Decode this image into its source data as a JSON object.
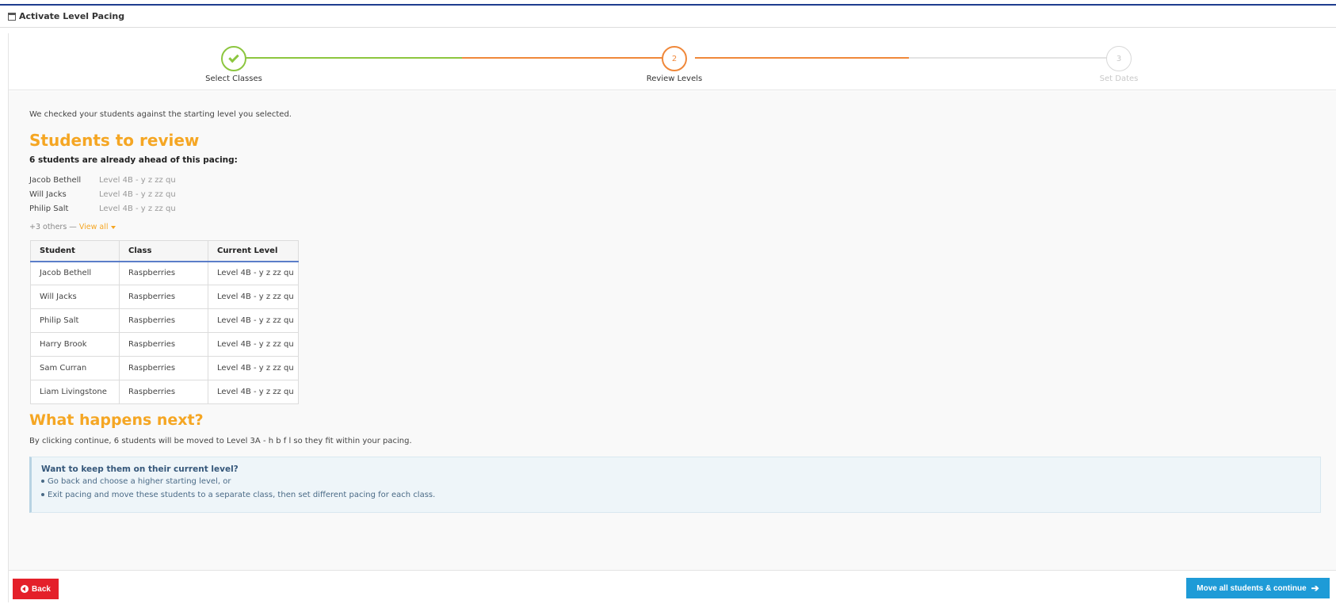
{
  "window": {
    "title": "Activate Level Pacing"
  },
  "steps": [
    {
      "number": "1",
      "label": "Select Classes",
      "state": "complete"
    },
    {
      "number": "2",
      "label": "Review Levels",
      "state": "current"
    },
    {
      "number": "3",
      "label": "Set Dates",
      "state": "upcoming"
    }
  ],
  "content": {
    "intro": "We checked your students against the starting level you selected.",
    "review_heading": "Students to review",
    "ahead_text": "6 students are already ahead of this pacing:",
    "preview": [
      {
        "name": "Jacob Bethell",
        "level": "Level 4B - y z zz qu"
      },
      {
        "name": "Will Jacks",
        "level": "Level 4B - y z zz qu"
      },
      {
        "name": "Philip Salt",
        "level": "Level 4B - y z zz qu"
      }
    ],
    "others_text": "+3 others —",
    "view_all": "View all",
    "table": {
      "headers": [
        "Student",
        "Class",
        "Current Level"
      ],
      "rows": [
        [
          "Jacob Bethell",
          "Raspberries",
          "Level 4B - y z zz qu"
        ],
        [
          "Will Jacks",
          "Raspberries",
          "Level 4B - y z zz qu"
        ],
        [
          "Philip Salt",
          "Raspberries",
          "Level 4B - y z zz qu"
        ],
        [
          "Harry Brook",
          "Raspberries",
          "Level 4B - y z zz qu"
        ],
        [
          "Sam Curran",
          "Raspberries",
          "Level 4B - y z zz qu"
        ],
        [
          "Liam Livingstone",
          "Raspberries",
          "Level 4B - y z zz qu"
        ]
      ]
    },
    "next_heading": "What happens next?",
    "next_text": "By clicking continue, 6 students will be moved to Level 3A - h b f l so they fit within your pacing.",
    "info": {
      "title": "Want to keep them on their current level?",
      "bullets": [
        "Go back and choose a higher starting level, or",
        "Exit pacing and move these students to a separate class, then set different pacing for each class."
      ]
    }
  },
  "footer": {
    "back_label": "Back",
    "continue_label": "Move all students & continue"
  },
  "colors": {
    "accent_orange": "#f5a623",
    "complete_green": "#8cc63f",
    "back_red": "#e4202a",
    "continue_blue": "#1e9bd7"
  }
}
